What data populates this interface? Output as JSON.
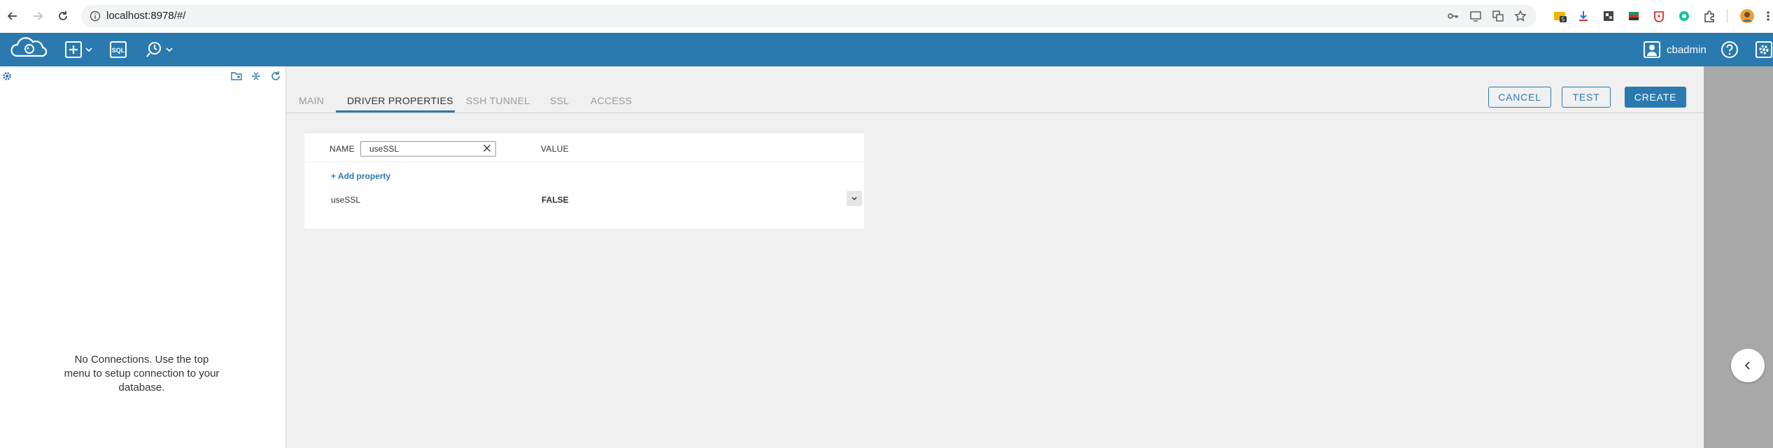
{
  "browser": {
    "url": "localhost:8978/#/",
    "extension_badge": "5"
  },
  "header": {
    "logo": "cloudbeaver-logo",
    "tools": [
      "new-connection-icon",
      "sql-editor-icon",
      "recent-icon"
    ],
    "sql_label": "SQL",
    "user": "cbadmin"
  },
  "sidebar": {
    "empty_message": "No Connections. Use the top menu to setup connection to your database."
  },
  "tabs": [
    {
      "label": "MAIN",
      "active": false
    },
    {
      "label": "DRIVER PROPERTIES",
      "active": true
    },
    {
      "label": "SSH TUNNEL",
      "active": false
    },
    {
      "label": "SSL",
      "active": false
    },
    {
      "label": "ACCESS",
      "active": false
    }
  ],
  "actions": {
    "cancel": "CANCEL",
    "test": "TEST",
    "create": "CREATE"
  },
  "properties": {
    "name_header": "NAME",
    "value_header": "VALUE",
    "filter_value": "useSSL",
    "add_property": "+ Add property",
    "rows": [
      {
        "name": "useSSL",
        "value": "FALSE"
      }
    ]
  },
  "colors": {
    "accent": "#2a7ab0",
    "sidebar_bg": "#ffffff",
    "workspace_bg": "#f0f0f0",
    "right_strip": "#a8a8a8"
  }
}
